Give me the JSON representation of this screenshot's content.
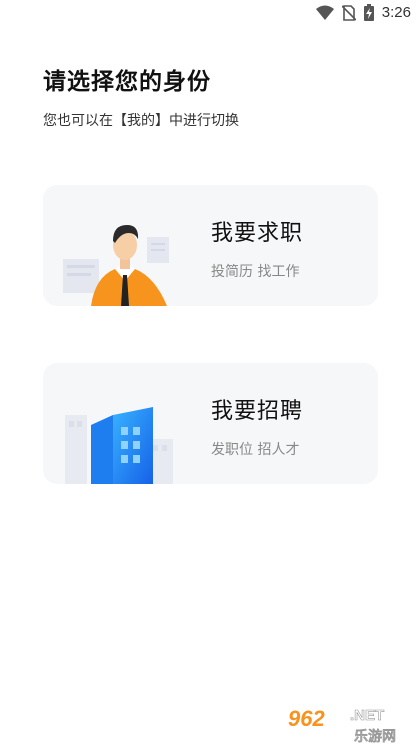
{
  "status_bar": {
    "time": "3:26",
    "icons": [
      "wifi-icon",
      "no-sim-icon",
      "battery-charging-icon"
    ]
  },
  "header": {
    "title": "请选择您的身份",
    "subtitle": "您也可以在【我的】中进行切换"
  },
  "cards": [
    {
      "title": "我要求职",
      "desc": "投简历 找工作",
      "illustration": "job-seeker-icon"
    },
    {
      "title": "我要招聘",
      "desc": "发职位 招人才",
      "illustration": "office-building-icon"
    }
  ],
  "watermark": {
    "main": "962",
    "suffix": ".NET",
    "sub": "乐游网"
  },
  "colors": {
    "card_bg": "#f6f7f9",
    "shirt_orange": "#f7941d",
    "building_blue": "#1e90ff",
    "watermark_orange": "#f7931e"
  }
}
